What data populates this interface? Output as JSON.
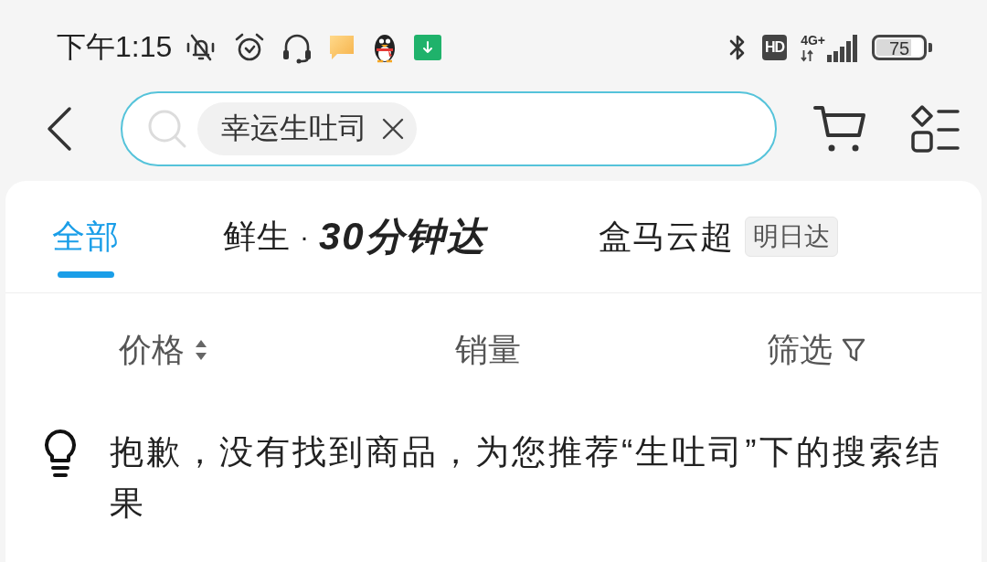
{
  "status_bar": {
    "time": "下午1:15",
    "hd": "HD",
    "network": "4G+",
    "battery": "75"
  },
  "search": {
    "query_tag": "幸运生吐司"
  },
  "tabs": [
    {
      "label": "全部",
      "selected": true
    },
    {
      "label": "鲜生",
      "separator": "·",
      "logo": "30分钟达",
      "selected": false
    },
    {
      "label": "盒马云超",
      "badge": "明日达",
      "selected": false
    }
  ],
  "sort_bar": [
    {
      "label": "价格",
      "kind": "sort"
    },
    {
      "label": "销量",
      "kind": "plain"
    },
    {
      "label": "筛选",
      "kind": "filter"
    }
  ],
  "notice": {
    "text": "抱歉，没有找到商品，为您推荐“生吐司”下的搜索结果"
  }
}
